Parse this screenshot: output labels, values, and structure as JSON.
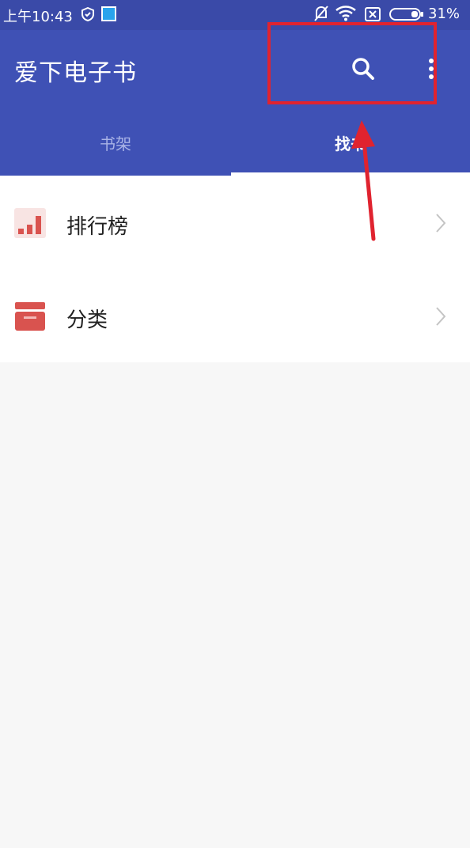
{
  "status_bar": {
    "time": "上午10:43",
    "battery_percent": "31%"
  },
  "app_bar": {
    "title": "爱下电子书"
  },
  "tabs": [
    {
      "label": "书架",
      "selected": false
    },
    {
      "label": "找书",
      "selected": true
    }
  ],
  "list_items": [
    {
      "label": "排行榜",
      "icon": "ranking-chart-icon"
    },
    {
      "label": "分类",
      "icon": "category-box-icon"
    }
  ],
  "colors": {
    "app_bar": "#3f51b5",
    "annotation": "#e0232f",
    "icon_red": "#d9534f"
  }
}
